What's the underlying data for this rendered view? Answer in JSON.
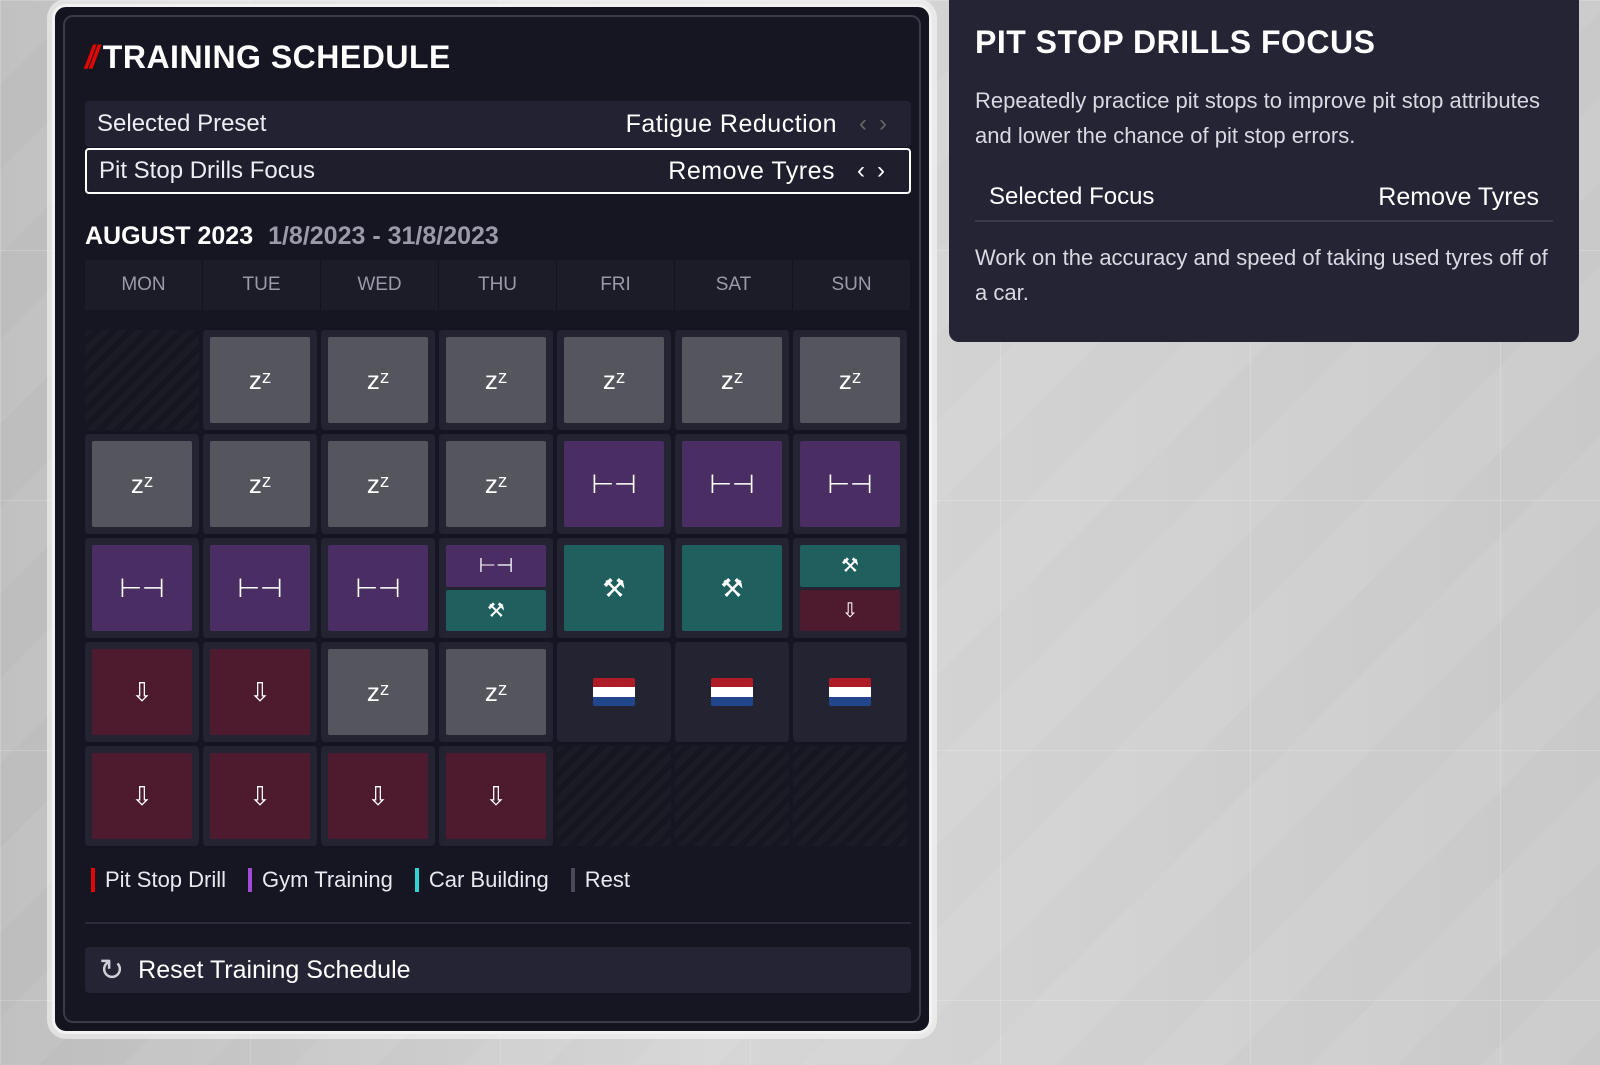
{
  "schedule": {
    "title": "TRAINING SCHEDULE",
    "preset_label": "Selected Preset",
    "preset_value": "Fatigue Reduction",
    "focus_label": "Pit Stop Drills Focus",
    "focus_value": "Remove Tyres",
    "month": "AUGUST 2023",
    "range": "1/8/2023 - 31/8/2023",
    "days": [
      "MON",
      "TUE",
      "WED",
      "THU",
      "FRI",
      "SAT",
      "SUN"
    ],
    "weeks": [
      [
        [],
        [
          "rest"
        ],
        [
          "rest"
        ],
        [
          "rest"
        ],
        [
          "rest"
        ],
        [
          "rest"
        ],
        [
          "rest"
        ]
      ],
      [
        [
          "rest"
        ],
        [
          "rest"
        ],
        [
          "rest"
        ],
        [
          "rest"
        ],
        [
          "gym"
        ],
        [
          "gym"
        ],
        [
          "gym"
        ]
      ],
      [
        [
          "gym"
        ],
        [
          "gym"
        ],
        [
          "gym"
        ],
        [
          "gym",
          "car"
        ],
        [
          "car"
        ],
        [
          "car"
        ],
        [
          "car",
          "pit"
        ]
      ],
      [
        [
          "pit"
        ],
        [
          "pit"
        ],
        [
          "rest"
        ],
        [
          "rest"
        ],
        [
          "race"
        ],
        [
          "race"
        ],
        [
          "race"
        ]
      ],
      [
        [
          "pit"
        ],
        [
          "pit"
        ],
        [
          "pit"
        ],
        [
          "pit"
        ],
        [],
        [],
        []
      ]
    ],
    "legend": [
      {
        "label": "Pit Stop Drill",
        "color": "#e10600"
      },
      {
        "label": "Gym Training",
        "color": "#a24bd8"
      },
      {
        "label": "Car Building",
        "color": "#2fd3d3"
      },
      {
        "label": "Rest",
        "color": "#4a4a58"
      }
    ],
    "reset_label": "Reset Training Schedule",
    "icons": {
      "rest": "zᶻ",
      "gym": "⊢⊣",
      "car": "⚒",
      "pit": "⇩",
      "race_flag_colors": [
        "#ae1c28",
        "#ffffff",
        "#21468b"
      ]
    }
  },
  "info": {
    "title": "PIT STOP DRILLS FOCUS",
    "description": "Repeatedly practice pit stops to improve pit stop attributes and lower the chance of pit stop errors.",
    "selected_focus_label": "Selected Focus",
    "selected_focus_value": "Remove Tyres",
    "focus_description": "Work on the accuracy and speed of taking used tyres off of a car."
  }
}
